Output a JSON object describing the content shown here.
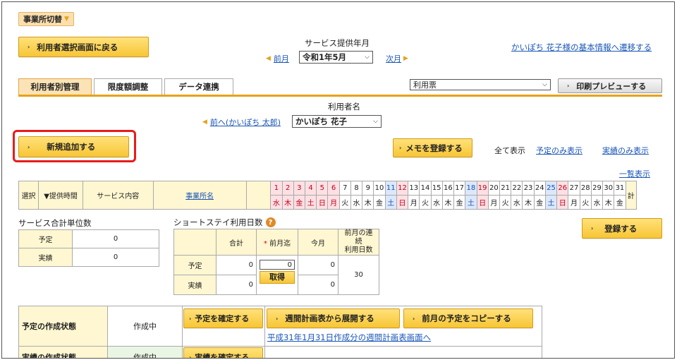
{
  "header": {
    "office_dropdown": "事業所切替",
    "back_button": "利用者選択画面に戻る",
    "month_title": "サービス提供年月",
    "prev_month": "前月",
    "month_select": "令和1年5月",
    "next_month": "次月",
    "transition_link": "かいぽち 花子様の基本情報へ遷移する"
  },
  "tabs": [
    {
      "label": "利用者別管理",
      "active": true
    },
    {
      "label": "限度額調整",
      "active": false
    },
    {
      "label": "データ連携",
      "active": false
    }
  ],
  "doc_select": "利用票",
  "print_button": "印刷プレビューする",
  "user": {
    "title": "利用者名",
    "prev_link": "前へ(かいぽち 太郎)",
    "user_select": "かいぽち 花子"
  },
  "add_button": "新規追加する",
  "memo_button": "メモを登録する",
  "filters": {
    "all": "全て表示",
    "plan_only": "予定のみ表示",
    "actual_only": "実績のみ表示"
  },
  "list_link": "一覧表示",
  "grid": {
    "headers": [
      "選択",
      "▼提供時間",
      "サービス内容",
      "事業所名"
    ],
    "total_label": "計",
    "days": [
      {
        "d": "1",
        "w": "水",
        "t": "pink"
      },
      {
        "d": "2",
        "w": "木",
        "t": "pink"
      },
      {
        "d": "3",
        "w": "金",
        "t": "pink"
      },
      {
        "d": "4",
        "w": "土",
        "t": "pink"
      },
      {
        "d": "5",
        "w": "日",
        "t": "pink"
      },
      {
        "d": "6",
        "w": "月",
        "t": "pink"
      },
      {
        "d": "7",
        "w": "火",
        "t": ""
      },
      {
        "d": "8",
        "w": "水",
        "t": ""
      },
      {
        "d": "9",
        "w": "木",
        "t": ""
      },
      {
        "d": "10",
        "w": "金",
        "t": ""
      },
      {
        "d": "11",
        "w": "土",
        "t": "blue"
      },
      {
        "d": "12",
        "w": "日",
        "t": "pink"
      },
      {
        "d": "13",
        "w": "月",
        "t": ""
      },
      {
        "d": "14",
        "w": "火",
        "t": ""
      },
      {
        "d": "15",
        "w": "水",
        "t": ""
      },
      {
        "d": "16",
        "w": "木",
        "t": ""
      },
      {
        "d": "17",
        "w": "金",
        "t": ""
      },
      {
        "d": "18",
        "w": "土",
        "t": "blue"
      },
      {
        "d": "19",
        "w": "日",
        "t": "pink"
      },
      {
        "d": "20",
        "w": "月",
        "t": ""
      },
      {
        "d": "21",
        "w": "火",
        "t": ""
      },
      {
        "d": "22",
        "w": "水",
        "t": ""
      },
      {
        "d": "23",
        "w": "木",
        "t": ""
      },
      {
        "d": "24",
        "w": "金",
        "t": ""
      },
      {
        "d": "25",
        "w": "土",
        "t": "blue"
      },
      {
        "d": "26",
        "w": "日",
        "t": "pink"
      },
      {
        "d": "27",
        "w": "月",
        "t": ""
      },
      {
        "d": "28",
        "w": "火",
        "t": ""
      },
      {
        "d": "29",
        "w": "水",
        "t": ""
      },
      {
        "d": "30",
        "w": "木",
        "t": ""
      },
      {
        "d": "31",
        "w": "金",
        "t": ""
      }
    ]
  },
  "service_units": {
    "title": "サービス合計単位数",
    "rows": [
      {
        "label": "予定",
        "value": "0"
      },
      {
        "label": "実績",
        "value": "0"
      }
    ]
  },
  "shortstay": {
    "title": "ショートステイ利用日数",
    "help_icon": "?",
    "col_total": "合計",
    "col_prev_mark": "*",
    "col_prev": "前月迄",
    "col_this": "今月",
    "col_cont_1": "前月の連続",
    "col_cont_2": "利用日数",
    "row_plan": "予定",
    "row_actual": "実績",
    "plan_total": "0",
    "plan_prev_input": "0",
    "plan_this": "0",
    "actual_total": "0",
    "actual_this": "0",
    "cont_days": "30",
    "get_button": "取得"
  },
  "register_button": "登録する",
  "status": {
    "plan_label": "予定の作成状態",
    "plan_value": "作成中",
    "confirm_plan": "予定を確定する",
    "expand_weekly": "週間計画表から展開する",
    "copy_prev": "前月の予定をコピーする",
    "weekly_link": "平成31年1月31日作成分の週間計画表画面へ",
    "actual_label": "実績の作成状態",
    "actual_value": "作成中",
    "confirm_actual": "実績を確定する"
  }
}
